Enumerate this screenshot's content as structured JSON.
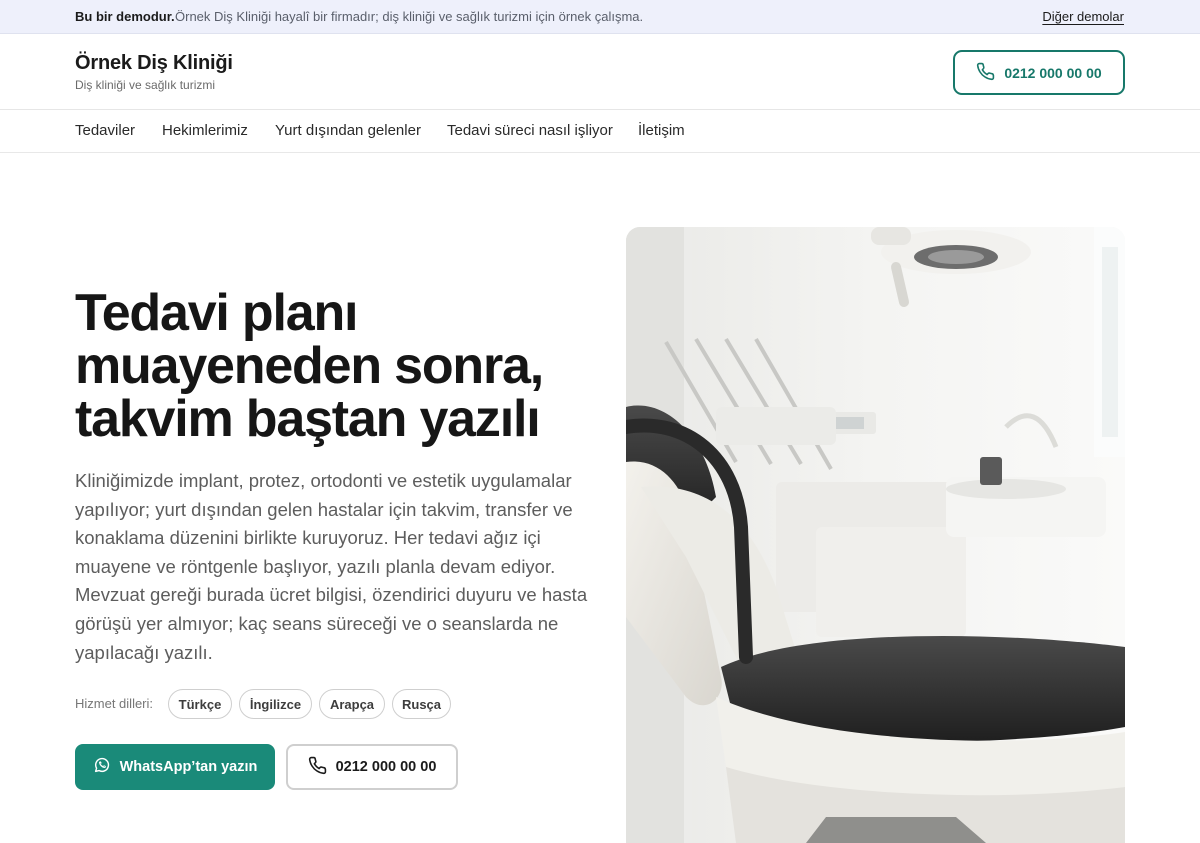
{
  "demo_bar": {
    "strong": "Bu bir demodur.",
    "text": "Örnek Diş Kliniği hayalî bir firmadır; diş kliniği ve sağlık turizmi için örnek çalışma.",
    "link": "Diğer demolar"
  },
  "header": {
    "brand_name": "Örnek Diş Kliniği",
    "brand_sub": "Diş kliniği ve sağlık turizmi",
    "phone": "0212 000 00 00",
    "phone_icon": "phone-icon"
  },
  "nav": {
    "items": [
      {
        "label": "Tedaviler"
      },
      {
        "label": "Hekimlerimiz"
      },
      {
        "label": "Yurt dışından gelenler"
      },
      {
        "label": "Tedavi süreci nasıl işliyor"
      },
      {
        "label": "İletişim"
      }
    ]
  },
  "hero": {
    "title": "Tedavi planı muayeneden sonra, takvim baştan yazılı",
    "description": "Kliniğimizde implant, protez, ortodonti ve estetik uygulamalar yapılıyor; yurt dışından gelen hastalar için takvim, transfer ve konaklama düzenini birlikte kuruyoruz. Her tedavi ağız içi muayene ve röntgenle başlıyor, yazılı planla devam ediyor. Mevzuat gereği burada ücret bilgisi, özendirici duyuru ve hasta görüşü yer almıyor; kaç seans süreceği ve o seanslarda ne yapılacağı yazılı.",
    "languages_label": "Hizmet dilleri:",
    "languages": [
      "Türkçe",
      "İngilizce",
      "Arapça",
      "Rusça"
    ],
    "whatsapp_button": "WhatsApp’tan yazın",
    "call_button": "0212 000 00 00",
    "image_subject": "dental-chair-photo"
  },
  "colors": {
    "accent": "#1a8a79",
    "accent_border": "#17786a",
    "demo_bar_bg": "#eef0fb"
  }
}
